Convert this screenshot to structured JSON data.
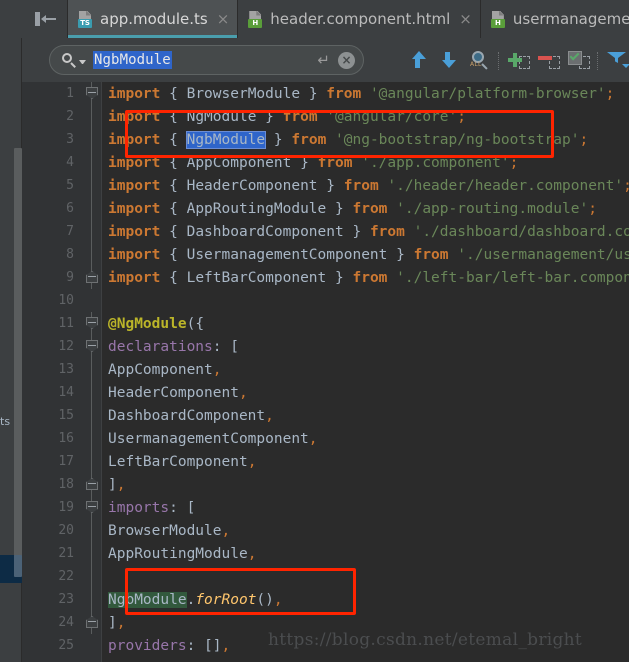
{
  "window": {
    "title": "app.module.ts"
  },
  "toolbar_left": {
    "chevron_icon": "chevron-down-icon",
    "pin_icon": "collapse-panel-icon"
  },
  "tabs": [
    {
      "label": "app.module.ts",
      "badge": "TS",
      "badge_color": "#3a9cb0",
      "active": true,
      "close_icon": "×"
    },
    {
      "label": "header.component.html",
      "badge": "H",
      "badge_color": "#5a9e3a",
      "active": false,
      "close_icon": "×"
    },
    {
      "label": "usermanagement.com",
      "badge": "H",
      "badge_color": "#5a9e3a",
      "active": false,
      "close_icon": ""
    }
  ],
  "search": {
    "icon": "search-icon",
    "dropdown_icon": "chevron-down-icon",
    "value": "NgbModule",
    "enter_icon": "↵",
    "clear_icon": "×",
    "selection_color": "#2f65ca"
  },
  "search_tools": [
    {
      "name": "find-previous-button",
      "icon": "arrow-up-icon",
      "color": "#4a9fd8"
    },
    {
      "name": "find-next-button",
      "icon": "arrow-down-icon",
      "color": "#4a9fd8"
    },
    {
      "name": "select-all-occurrences-button",
      "icon": "magnifier-all-icon",
      "label": "ALL"
    },
    {
      "name": "add-selection-button",
      "icon": "plus-selection-icon",
      "color": "#59a869"
    },
    {
      "name": "remove-selection-button",
      "icon": "minus-selection-icon",
      "color": "#d9534f"
    },
    {
      "name": "select-all-button",
      "icon": "checkbox-selection-icon",
      "color": "#59a869"
    },
    {
      "name": "filter-button",
      "icon": "funnel-icon",
      "color": "#4a9fd8"
    }
  ],
  "left_panel": {
    "label": "ts"
  },
  "editor": {
    "lines": [
      {
        "n": "1",
        "fold": "start",
        "text": "import { BrowserModule } from '@angular/platform-browser';"
      },
      {
        "n": "2",
        "fold": "none",
        "text": "import { NgModule } from '@angular/core';"
      },
      {
        "n": "3",
        "fold": "none",
        "text": "import { NgbModule } from '@ng-bootstrap/ng-bootstrap';"
      },
      {
        "n": "4",
        "fold": "none",
        "text": "import { AppComponent } from './app.component';"
      },
      {
        "n": "5",
        "fold": "none",
        "text": "import { HeaderComponent } from './header/header.component';"
      },
      {
        "n": "6",
        "fold": "none",
        "text": "import { AppRoutingModule } from './app-routing.module';"
      },
      {
        "n": "7",
        "fold": "none",
        "text": "import { DashboardComponent } from './dashboard/dashboard.compo"
      },
      {
        "n": "8",
        "fold": "none",
        "text": "import { UsermanagementComponent } from './usermanagement/userm"
      },
      {
        "n": "9",
        "fold": "end",
        "text": "import { LeftBarComponent } from './left-bar/left-bar.component"
      },
      {
        "n": "10",
        "fold": "none",
        "text": ""
      },
      {
        "n": "11",
        "fold": "start",
        "text": "@NgModule({"
      },
      {
        "n": "12",
        "fold": "start",
        "text": "  declarations: ["
      },
      {
        "n": "13",
        "fold": "none",
        "text": "    AppComponent,"
      },
      {
        "n": "14",
        "fold": "none",
        "text": "    HeaderComponent,"
      },
      {
        "n": "15",
        "fold": "none",
        "text": "    DashboardComponent,"
      },
      {
        "n": "16",
        "fold": "none",
        "text": "    UsermanagementComponent,"
      },
      {
        "n": "17",
        "fold": "none",
        "text": "    LeftBarComponent,"
      },
      {
        "n": "18",
        "fold": "end",
        "text": "  ],"
      },
      {
        "n": "19",
        "fold": "start",
        "text": "  imports: ["
      },
      {
        "n": "20",
        "fold": "none",
        "text": "    BrowserModule,"
      },
      {
        "n": "21",
        "fold": "none",
        "text": "    AppRoutingModule,"
      },
      {
        "n": "22",
        "fold": "none",
        "text": ""
      },
      {
        "n": "23",
        "fold": "none",
        "text": "    NgbModule.forRoot(),"
      },
      {
        "n": "24",
        "fold": "end",
        "text": "  ],"
      },
      {
        "n": "25",
        "fold": "none",
        "text": "  providers: [],"
      }
    ]
  },
  "annotations": {
    "box1_note": "highlight-import-ngbmodule",
    "box2_note": "highlight-ngbmodule-forroot",
    "box_color": "#ff2400"
  },
  "watermark": {
    "text": "https://blog.csdn.net/etemal_bright"
  }
}
